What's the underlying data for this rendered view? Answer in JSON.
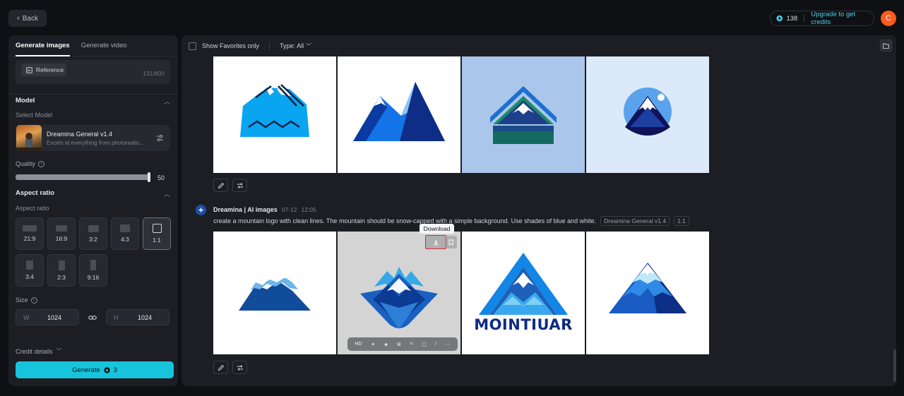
{
  "header": {
    "back_label": "Back",
    "credits_count": "138",
    "upgrade_label": "Upgrade to get credits",
    "avatar_initial": "C"
  },
  "left_panel": {
    "tabs": [
      {
        "label": "Generate images",
        "active": true
      },
      {
        "label": "Generate video",
        "active": false
      }
    ],
    "prompt": {
      "reference_label": "Reference",
      "char_count": "131/800"
    },
    "model": {
      "section_title": "Model",
      "select_label": "Select Model",
      "name": "Dreamina General v1.4",
      "description": "Excels at everything from photorealis..."
    },
    "quality": {
      "label": "Quality",
      "value": "50"
    },
    "aspect_ratio": {
      "section_title": "Aspect ratio",
      "label": "Aspect ratio",
      "options": [
        "21:9",
        "16:9",
        "3:2",
        "4:3",
        "1:1",
        "3:4",
        "2:3",
        "9:16"
      ],
      "selected": "1:1"
    },
    "size": {
      "label": "Size",
      "width_label": "W",
      "width_value": "1024",
      "height_label": "H",
      "height_value": "1024"
    },
    "credit_details_label": "Credit details",
    "generate_label": "Generate",
    "generate_cost": "3"
  },
  "main": {
    "show_favorites_label": "Show Favorites only",
    "type_filter_label": "Type: All",
    "generation": {
      "author": "Dreamina | AI images",
      "date": "07-12",
      "time": "12:05",
      "prompt": "create a mountain logo with clean lines. The mountain should be snow-capped with a simple background. Use shades of blue and white.",
      "model_chip": "Dreamina General v1.4",
      "ratio_chip": "1:1"
    },
    "tooltip": "Download",
    "hover_toolbar": [
      "HD"
    ],
    "logo_text": "MOINTIUAR"
  },
  "colors": {
    "accent": "#16c5dc",
    "avatar": "#ff5a1f",
    "highlight": "#e0262b"
  }
}
